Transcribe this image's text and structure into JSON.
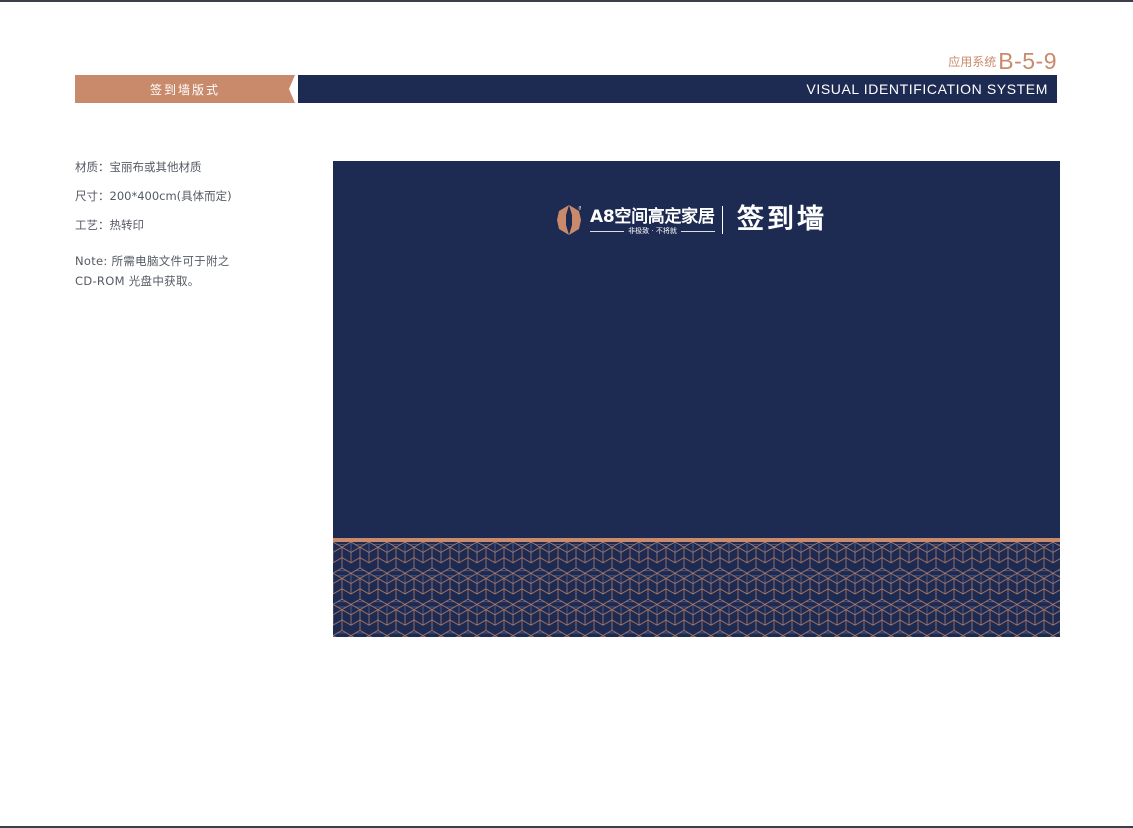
{
  "header": {
    "code_prefix": "应用系统",
    "code_number": "B-5-9",
    "section_title": "签到墙版式",
    "system_label": "VISUAL IDENTIFICATION SYSTEM"
  },
  "specs": {
    "material": "材质：宝丽布或其他材质",
    "size": "尺寸：200*400cm(具体而定)",
    "craft": "工艺：热转印",
    "note_line1": "Note: 所需电脑文件可于附之",
    "note_line2": "CD-ROM 光盘中获取。"
  },
  "wall": {
    "brand_name": "A8空间高定家居",
    "slogan": "非极致 · 不将就",
    "title": "签到墙",
    "trademark": "®"
  },
  "colors": {
    "navy": "#1d2a52",
    "copper": "#c98a6c",
    "white": "#ffffff",
    "text_gray": "#555a63"
  },
  "icons": {
    "brand_logo": "brand-logo-icon",
    "tab_notch": "notch-arrow-icon"
  }
}
